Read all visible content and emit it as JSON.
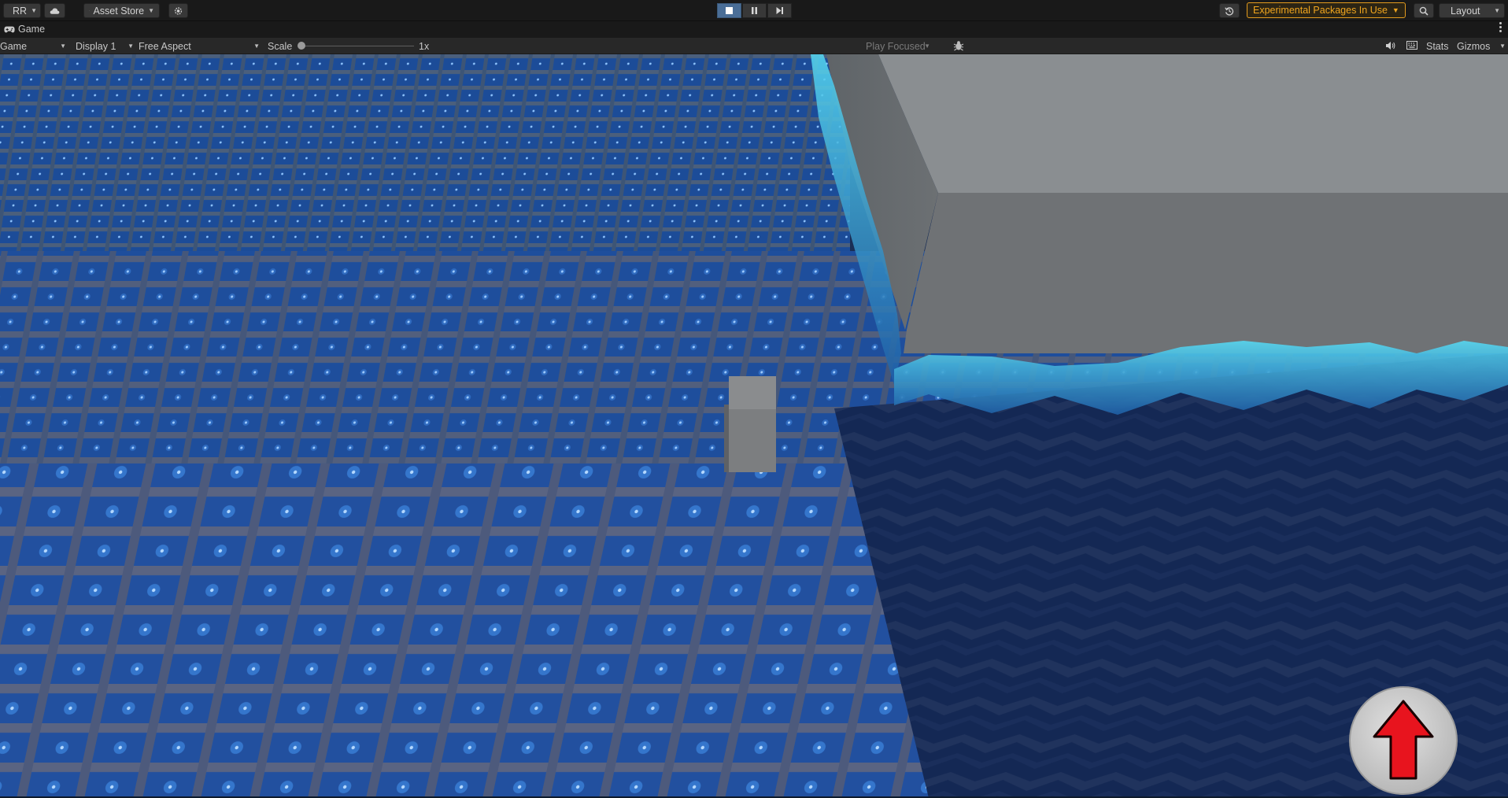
{
  "topbar": {
    "account_label": "RR",
    "asset_store_label": "Asset Store",
    "experimental_label": "Experimental Packages In Use",
    "layout_label": "Layout"
  },
  "tab": {
    "title": "Game"
  },
  "game_toolbar": {
    "view_mode": "Game",
    "display": "Display 1",
    "aspect": "Free Aspect",
    "scale_label": "Scale",
    "scale_value": "1x",
    "play_mode": "Play Focused",
    "stats_label": "Stats",
    "gizmos_label": "Gizmos"
  },
  "colors": {
    "accent_active": "#4a6e97",
    "experimental_orange": "#f0a51e",
    "water_deep": "#1f4fa0",
    "water_highlight": "#3ec9e8",
    "arrow_red": "#e8141e"
  },
  "icons": {
    "account": "account-icon",
    "cloud": "cloud-icon",
    "asset_store": "shopping-bag-icon",
    "settings": "gear-icon",
    "play": "stop-square-icon",
    "pause": "pause-icon",
    "step": "step-icon",
    "history": "history-icon",
    "search": "search-icon",
    "mute": "speaker-icon",
    "keyboard": "keyboard-icon",
    "bug": "bug-icon",
    "move_up": "up-arrow-icon"
  }
}
